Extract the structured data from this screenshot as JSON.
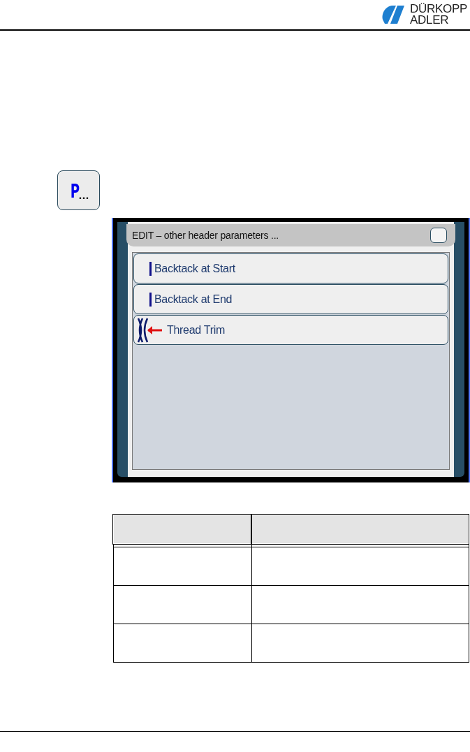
{
  "logo": {
    "lines": [
      "DÜRKOPP",
      "ADLER"
    ]
  },
  "parameter_button": {
    "letter": "P",
    "suffix": "..."
  },
  "screen": {
    "title": "EDIT – other header parameters ...",
    "checkbox": {
      "checked": false
    },
    "items": [
      {
        "kind": "backtack",
        "label": "Backtack at Start"
      },
      {
        "kind": "backtack",
        "label": "Backtack at End"
      },
      {
        "kind": "trim",
        "label": "Thread Trim"
      }
    ]
  }
}
